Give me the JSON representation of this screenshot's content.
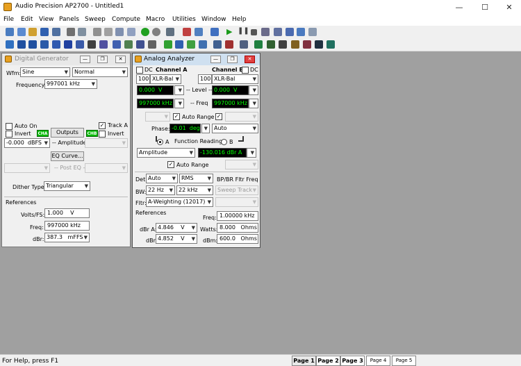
{
  "window": {
    "title": "Audio Precision AP2700 - Untitled1",
    "minimize": "—",
    "maximize": "☐",
    "close": "✕"
  },
  "menu": [
    "File",
    "Edit",
    "View",
    "Panels",
    "Sweep",
    "Compute",
    "Macro",
    "Utilities",
    "Window",
    "Help"
  ],
  "colors": {
    "green_readout": "#00ff00",
    "readout_bg": "#000000"
  },
  "generator": {
    "title": "Digital Generator",
    "wfm_label": "Wfm:",
    "wfm_value": "Sine",
    "wfm_mode": "Normal",
    "freq_label": "Frequency:",
    "freq_value": "997001 kHz",
    "auto_on": "Auto On",
    "track_a": "Track A",
    "invert_a": "Invert",
    "invert_b": "Invert",
    "cha": "CHA",
    "chb": "CHB",
    "outputs": "Outputs",
    "amp_value": "-0.000",
    "amp_unit": "dBFS",
    "amplitude_label": "-- Amplitude",
    "eq_curve": "EQ Curve...",
    "post_eq": "-- Post EQ --",
    "dither_label": "Dither Type:",
    "dither_value": "Triangular",
    "refs_label": "References",
    "vfs_label": "Volts/FS:",
    "vfs_value": "1.000",
    "vfs_unit": "V",
    "rfreq_label": "Freq:",
    "rfreq_value": "997000 kHz",
    "dbr_label": "dBr:",
    "dbr_value": "387.3",
    "dbr_unit": "mFFS"
  },
  "analyzer": {
    "title": "Analog Analyzer",
    "dc_a": "DC",
    "cha_label": "Channel A",
    "chb_label": "Channel B",
    "dc_b": "DC",
    "imp_a": "100k",
    "conn_a": "XLR-Bal",
    "imp_b": "100k",
    "conn_b": "XLR-Bal",
    "level_a": "0.000",
    "level_a_unit": "V",
    "level_label": "-- Level --",
    "level_b": "0.000",
    "level_b_unit": "V",
    "freq_a": "997000 kHz",
    "freq_label": "-- Freq",
    "freq_b": "997000 kHz",
    "auto_range": "Auto Range",
    "phase_label": "Phase:",
    "phase_value": "-0.01",
    "phase_unit": "deg",
    "phase_mode": "Auto",
    "func_label": "Function Reading",
    "radio_a": "A",
    "radio_b": "B",
    "func_value": "Amplitude",
    "func_readout": "-130.016 dBr A",
    "auto_range2": "Auto Range",
    "det_label": "Det:",
    "det_value": "Auto",
    "det_type": "RMS",
    "bpbr_label": "BP/BR Fltr Freq",
    "bw_label": "BW:",
    "bw_lo": "22 Hz",
    "bw_hi": "22 kHz",
    "sweep_track": "Sweep Track",
    "fltr_label": "Fltr:",
    "fltr_value": "A-Weighting  (12017)",
    "refs_label": "References",
    "rfreq_label": "Freq:",
    "rfreq_value": "1.00000 kHz",
    "dbra_label": "dBr A:",
    "dbra_value": "4.846",
    "dbra_unit": "V",
    "watts_label": "Watts:",
    "watts_value": "8.000",
    "watts_unit": "Ohms",
    "dbrb_label": "dBr:",
    "dbrb_value": "4.852",
    "dbrb_unit": "V",
    "dbm_label": "dBm:",
    "dbm_value": "600.0",
    "dbm_unit": "Ohms"
  },
  "status": {
    "help": "For Help, press F1",
    "pages": [
      "Page 1",
      "Page 2",
      "Page 3",
      "Page 4",
      "Page 5"
    ]
  }
}
